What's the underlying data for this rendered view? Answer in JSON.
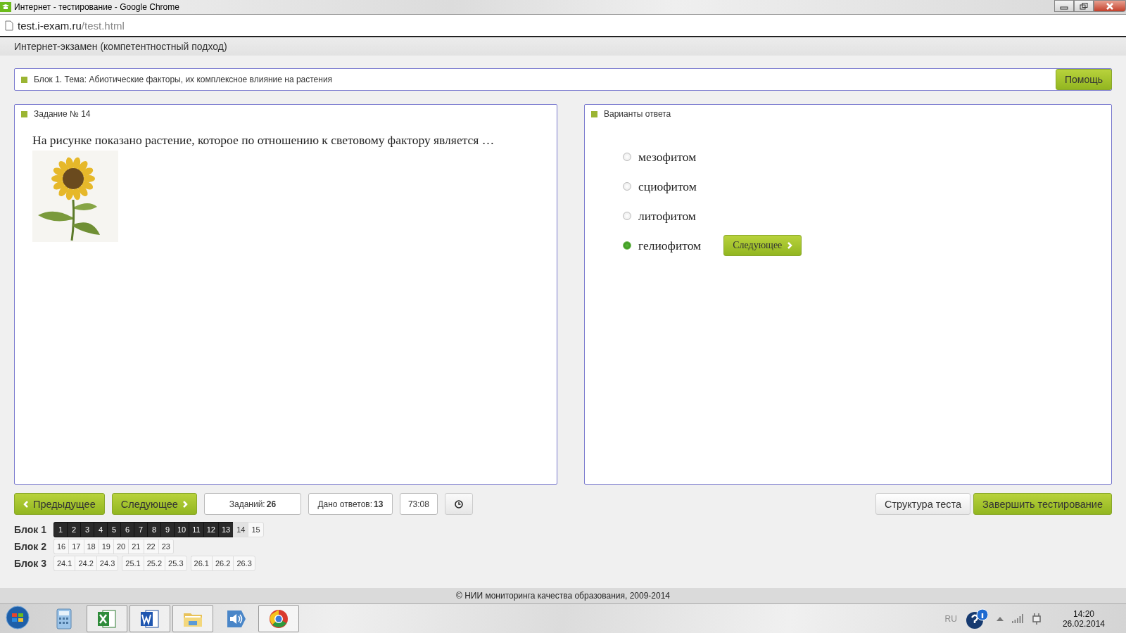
{
  "window": {
    "title": "Интернет - тестирование - Google Chrome"
  },
  "address_bar": {
    "host": "test.i-exam.ru",
    "path": "/test.html"
  },
  "app_header": "Интернет-экзамен (компетентностный подход)",
  "topic": "Блок 1. Тема: Абиотические факторы, их комплексное влияние на растения",
  "help_button": "Помощь",
  "task_panel": {
    "title": "Задание № 14",
    "question": "На рисунке показано растение, которое по отношению к световому фактору является …"
  },
  "answers_panel": {
    "title": "Варианты ответа",
    "options": [
      {
        "label": "мезофитом",
        "selected": false
      },
      {
        "label": "сциофитом",
        "selected": false
      },
      {
        "label": "литофитом",
        "selected": false
      },
      {
        "label": "гелиофитом",
        "selected": true
      }
    ],
    "next_button": "Следующее"
  },
  "nav": {
    "prev": "Предыдущее",
    "next": "Следующее",
    "tasks": "Заданий: **26**",
    "answers": "Дано ответов: **13**",
    "timer": "73:08",
    "structure": "Структура теста",
    "finish": "Завершить тестирование"
  },
  "blocks": [
    {
      "label": "Блок 1",
      "groups": [
        [
          {
            "n": "1",
            "answered": true,
            "current": false
          },
          {
            "n": "2",
            "answered": true,
            "current": false
          },
          {
            "n": "3",
            "answered": true,
            "current": false
          },
          {
            "n": "4",
            "answered": true,
            "current": false
          },
          {
            "n": "5",
            "answered": true,
            "current": false
          },
          {
            "n": "6",
            "answered": true,
            "current": false
          },
          {
            "n": "7",
            "answered": true,
            "current": false
          },
          {
            "n": "8",
            "answered": true,
            "current": false
          },
          {
            "n": "9",
            "answered": true,
            "current": false
          },
          {
            "n": "10",
            "answered": true,
            "current": false
          },
          {
            "n": "11",
            "answered": true,
            "current": false
          },
          {
            "n": "12",
            "answered": true,
            "current": false
          },
          {
            "n": "13",
            "answered": true,
            "current": false
          },
          {
            "n": "14",
            "answered": false,
            "current": true
          },
          {
            "n": "15",
            "answered": false,
            "current": false
          }
        ]
      ]
    },
    {
      "label": "Блок 2",
      "groups": [
        [
          {
            "n": "16",
            "answered": false,
            "current": false
          },
          {
            "n": "17",
            "answered": false,
            "current": false
          },
          {
            "n": "18",
            "answered": false,
            "current": false
          },
          {
            "n": "19",
            "answered": false,
            "current": false
          },
          {
            "n": "20",
            "answered": false,
            "current": false
          },
          {
            "n": "21",
            "answered": false,
            "current": false
          },
          {
            "n": "22",
            "answered": false,
            "current": false
          },
          {
            "n": "23",
            "answered": false,
            "current": false
          }
        ]
      ]
    },
    {
      "label": "Блок 3",
      "groups": [
        [
          {
            "n": "24.1",
            "answered": false,
            "current": false
          },
          {
            "n": "24.2",
            "answered": false,
            "current": false
          },
          {
            "n": "24.3",
            "answered": false,
            "current": false
          }
        ],
        [
          {
            "n": "25.1",
            "answered": false,
            "current": false
          },
          {
            "n": "25.2",
            "answered": false,
            "current": false
          },
          {
            "n": "25.3",
            "answered": false,
            "current": false
          }
        ],
        [
          {
            "n": "26.1",
            "answered": false,
            "current": false
          },
          {
            "n": "26.2",
            "answered": false,
            "current": false
          },
          {
            "n": "26.3",
            "answered": false,
            "current": false
          }
        ]
      ]
    }
  ],
  "footer": "© НИИ мониторинга качества образования, 2009-2014",
  "taskbar": {
    "language": "RU",
    "time": "14:20",
    "date": "26.02.2014"
  }
}
